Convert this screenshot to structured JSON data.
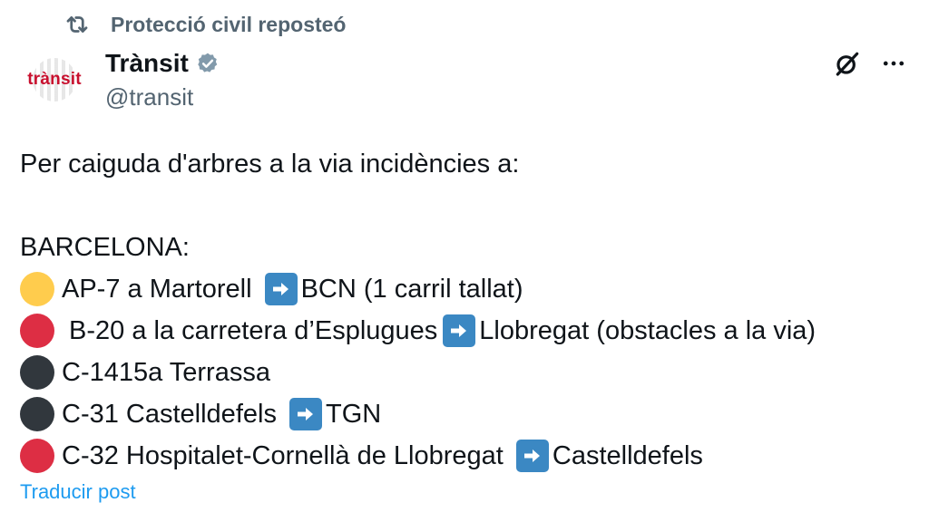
{
  "repost": {
    "icon": "repost-icon",
    "text": "Protecció civil reposteó"
  },
  "author": {
    "avatar_text": "trànsit",
    "display_name": "Trànsit",
    "handle": "@transit",
    "verified_icon": "verified-badge-icon"
  },
  "actions": {
    "grok_icon": "grok-icon",
    "more_icon": "more-icon"
  },
  "tweet": {
    "intro": "Per caiguda d'arbres a la via incidències a:",
    "region": "BARCELONA:",
    "incidents": [
      {
        "dot": "yellow",
        "road": "AP-7 a Martorell ",
        "destination": "BCN (1 carril tallat)"
      },
      {
        "dot": "red",
        "road": " B-20 a la carretera d’Esplugues",
        "destination": "Llobregat (obstacles a la via)"
      },
      {
        "dot": "black",
        "road": "C-1415a Terrassa",
        "destination": ""
      },
      {
        "dot": "black",
        "road": "C-31 Castelldefels ",
        "destination": "TGN"
      },
      {
        "dot": "red",
        "road": "C-32 Hospitalet-Cornellà de Llobregat ",
        "destination": "Castelldefels"
      }
    ]
  },
  "translate_link": "Traducir post",
  "colors": {
    "yellow": "#ffcc4d",
    "red": "#dd2e44",
    "black": "#31373d",
    "link_blue": "#1d9bf0",
    "arrow_blue": "#3b88c3",
    "muted_text": "#536471",
    "avatar_red": "#c8102e"
  }
}
